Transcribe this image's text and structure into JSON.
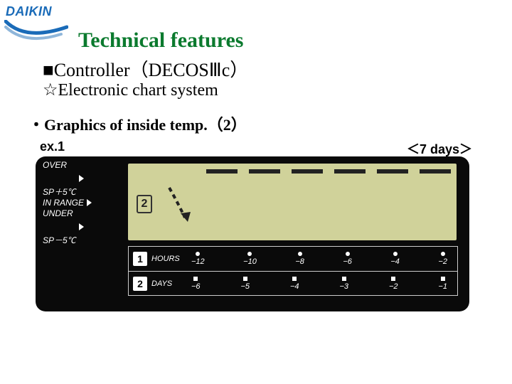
{
  "logo_text": "DAIKIN",
  "title": "Technical features",
  "sub1": "■Controller（DECOSⅢc）",
  "sub2": "☆Electronic chart system",
  "bullet": "・Graphics of inside temp.（2）",
  "ex_label": "ex.1",
  "days_label": "＜7 days＞",
  "left_labels": {
    "over_top": "OVER",
    "over_bot": "SP＋5℃",
    "in_range": "IN RANGE",
    "under_top": "UNDER",
    "under_bot": "SP－5℃"
  },
  "lcd_box_digit": "2",
  "scale": {
    "row1_unit_num": "1",
    "row1_unit_label": "HOURS",
    "row1_values": [
      "−12",
      "−10",
      "−8",
      "−6",
      "−4",
      "−2"
    ],
    "row2_unit_num": "2",
    "row2_unit_label": "DAYS",
    "row2_values": [
      "−6",
      "−5",
      "−4",
      "−3",
      "−2",
      "−1"
    ]
  },
  "chart_data": {
    "type": "bar",
    "title": "Graphics of inside temp. (7 days)",
    "categories_days": [
      -6,
      -5,
      -4,
      -3,
      -2,
      -1
    ],
    "status": [
      "OVER",
      "OVER",
      "OVER",
      "OVER",
      "OVER",
      "OVER"
    ],
    "bands": [
      "OVER SP+5℃",
      "IN RANGE",
      "UNDER SP−5℃"
    ],
    "selected_scale": 2
  }
}
